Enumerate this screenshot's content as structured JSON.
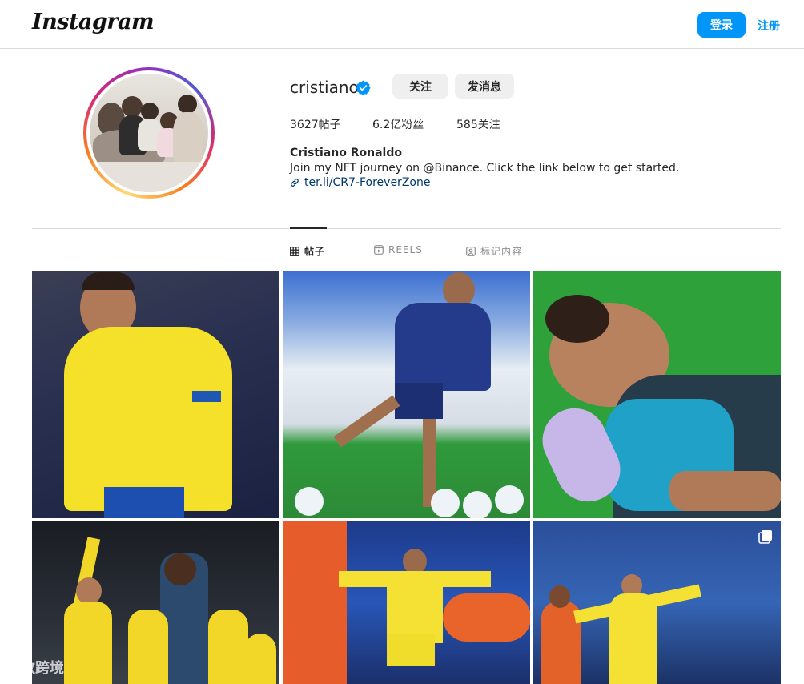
{
  "header": {
    "logo_text": "Instagram",
    "login_label": "登录",
    "signup_label": "注册",
    "accent_color": "#0095f6"
  },
  "profile": {
    "username": "cristiano",
    "verified_icon": "verified-badge-icon",
    "follow_label": "关注",
    "message_label": "发消息",
    "stats": {
      "posts": "3627帖子",
      "followers": "6.2亿粉丝",
      "following": "585关注"
    },
    "full_name": "Cristiano Ronaldo",
    "bio": "Join my NFT journey on @Binance. Click the link below to get started.",
    "link": "ter.li/CR7-ForeverZone"
  },
  "tabs": [
    {
      "label": "帖子",
      "icon": "grid-icon",
      "active": true
    },
    {
      "label": "REELS",
      "icon": "reels-icon",
      "active": false
    },
    {
      "label": "标记内容",
      "icon": "tagged-icon",
      "active": false
    }
  ],
  "watermark": "大数跨境"
}
